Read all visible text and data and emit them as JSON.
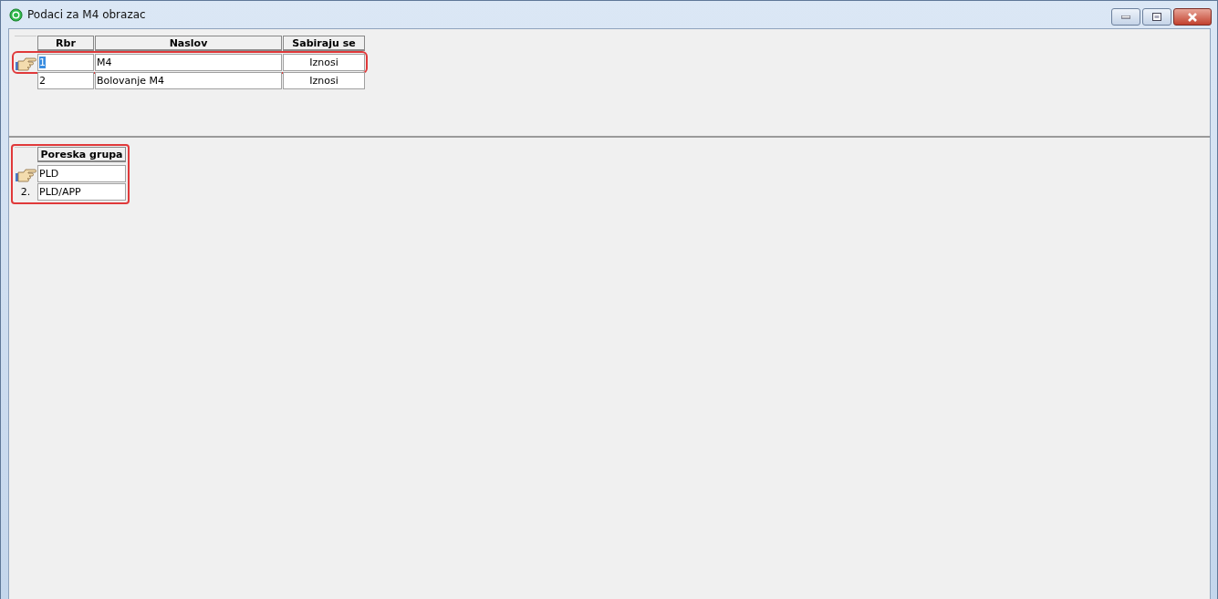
{
  "window": {
    "title": "Podaci za M4 obrazac"
  },
  "top_grid": {
    "columns": [
      "Rbr",
      "Naslov",
      "Sabiraju se"
    ],
    "rows": [
      {
        "selected": true,
        "highlighted": true,
        "cells": [
          "1",
          "M4",
          "Iznosi"
        ]
      },
      {
        "selected": false,
        "highlighted": false,
        "cells": [
          "2",
          "Bolovanje M4",
          "Iznosi"
        ]
      }
    ]
  },
  "bottom_grid": {
    "highlighted": true,
    "columns": [
      "Poreska grupa"
    ],
    "rows": [
      {
        "selected": true,
        "indicator": "",
        "cells": [
          "PLD"
        ]
      },
      {
        "selected": false,
        "indicator": "2.",
        "cells": [
          "PLD/APP"
        ]
      }
    ]
  }
}
